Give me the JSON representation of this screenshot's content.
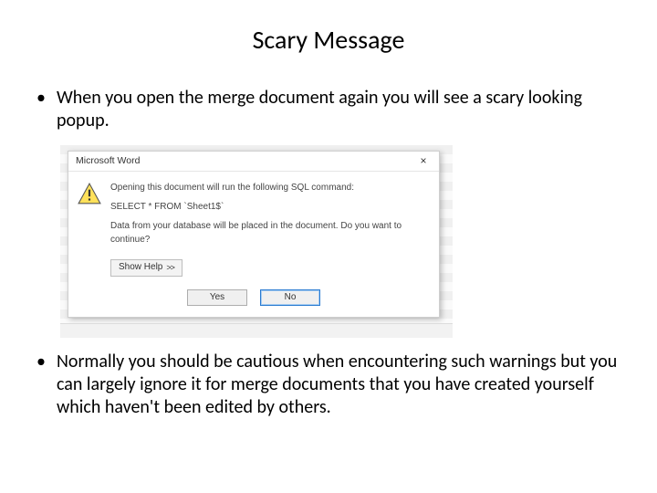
{
  "slide": {
    "title": "Scary Message",
    "bullets": [
      "When you open the merge document again you will see a scary looking popup.",
      "Normally you should be cautious when encountering such warnings but you can largely ignore it for merge documents that you have created yourself which haven't been edited by others."
    ]
  },
  "dialog": {
    "title": "Microsoft Word",
    "close_label": "×",
    "icon": "warning-triangle-icon",
    "lines": {
      "intro": "Opening this document will run the following SQL command:",
      "sql": "SELECT * FROM `Sheet1$`",
      "question": "Data from your database will be placed in the document. Do you want to continue?"
    },
    "show_help_label": "Show Help",
    "yes_label": "Yes",
    "no_label": "No"
  }
}
